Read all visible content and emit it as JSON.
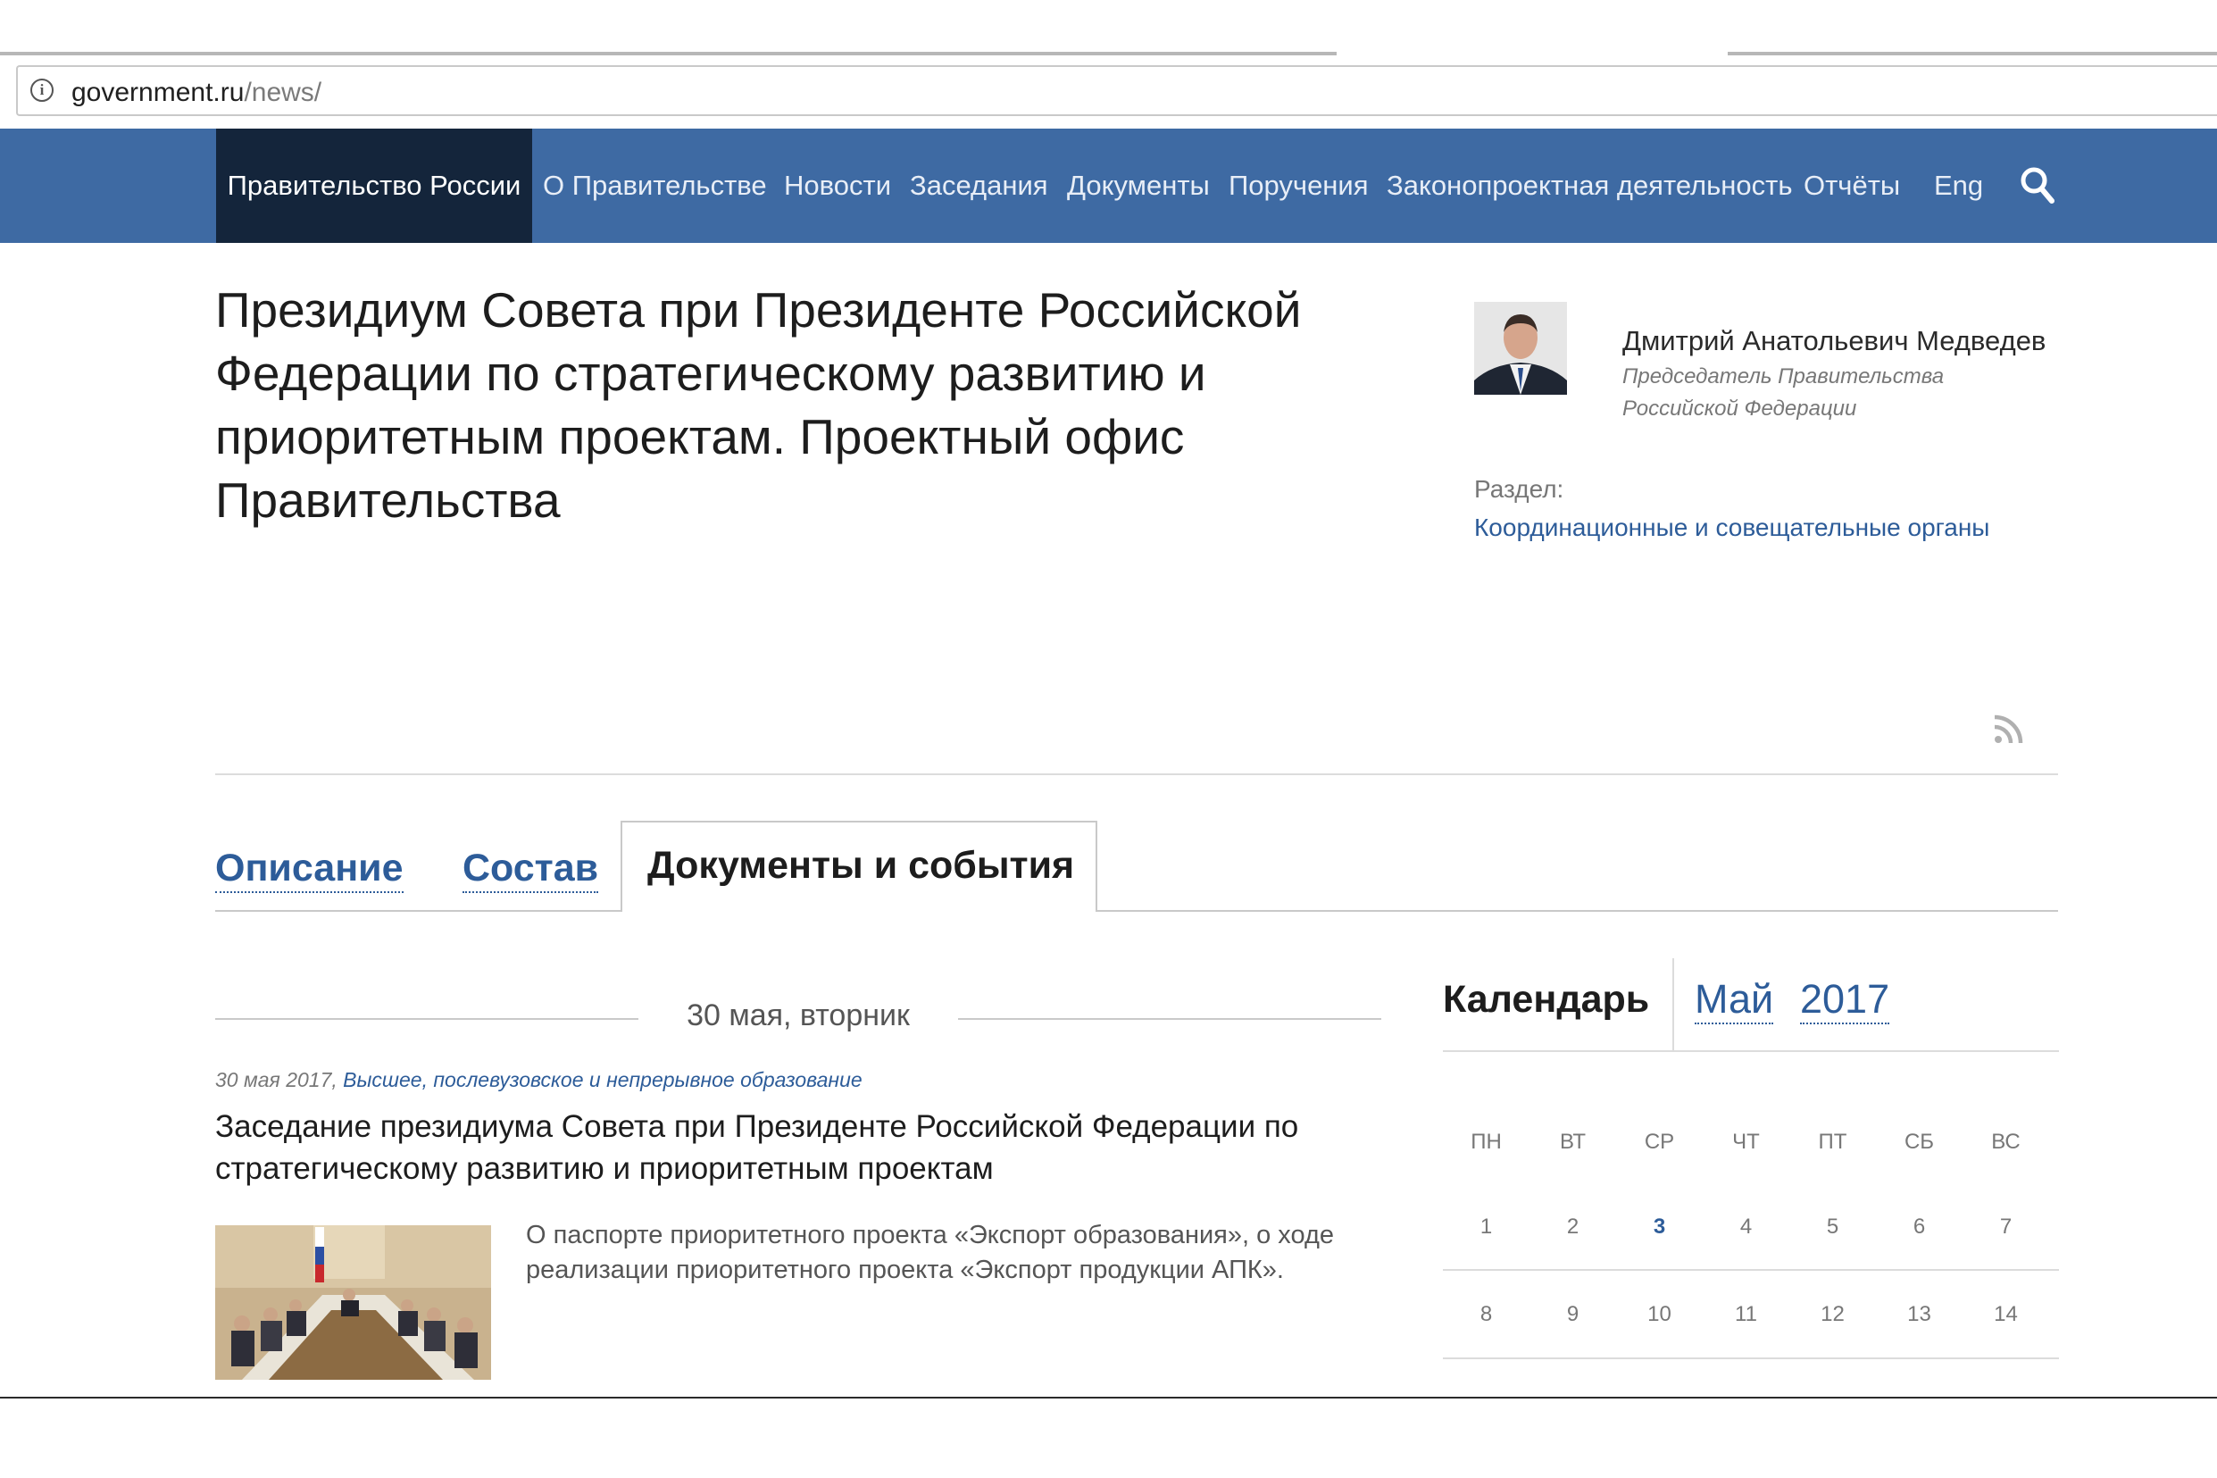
{
  "browser": {
    "url_host": "government.ru",
    "url_path": "/news/"
  },
  "nav": {
    "brand": "Правительство России",
    "items": [
      {
        "label": "О Правительстве"
      },
      {
        "label": "Новости"
      },
      {
        "label": "Заседания"
      },
      {
        "label": "Документы"
      },
      {
        "label": "Поручения"
      },
      {
        "label": "Законопроектная деятельность"
      },
      {
        "label": "Отчёты"
      },
      {
        "label": "Eng"
      }
    ],
    "search_icon": "search-icon"
  },
  "header": {
    "title": "Президиум Совета при Президенте Российской Федерации по стратегическому развитию и приоритетным проектам. Проектный офис Правительства",
    "person": {
      "name": "Дмитрий Анатольевич Медведев",
      "role": "Председатель Правительства Российской Федерации"
    },
    "section_label": "Раздел:",
    "section_link": "Координационные и совещательные органы"
  },
  "tabs": {
    "description": "Описание",
    "members": "Состав",
    "documents": "Документы и события"
  },
  "news": {
    "date_header": "30 мая, вторник",
    "date": "30 мая 2017,",
    "category": "Высшее, послевузовское и непрерывное образование",
    "title": "Заседание президиума Совета при Президенте Российской Федерации по стратегическому развитию и приоритетным проектам",
    "summary": "О паспорте приоритетного проекта «Экспорт образования», о ходе реализации приоритетного проекта «Экспорт продукции АПК»."
  },
  "calendar": {
    "title": "Календарь",
    "month": "Май",
    "year": "2017",
    "weekdays": [
      "ПН",
      "ВТ",
      "СР",
      "ЧТ",
      "ПТ",
      "СБ",
      "ВС"
    ],
    "week1": [
      "1",
      "2",
      "3",
      "4",
      "5",
      "6",
      "7"
    ],
    "week2": [
      "8",
      "9",
      "10",
      "11",
      "12",
      "13",
      "14"
    ],
    "highlighted_day": "3",
    "colors": {
      "link": "#2d5c99",
      "nav_bg": "#3e6aa3",
      "brand_bg": "#14253b"
    }
  }
}
